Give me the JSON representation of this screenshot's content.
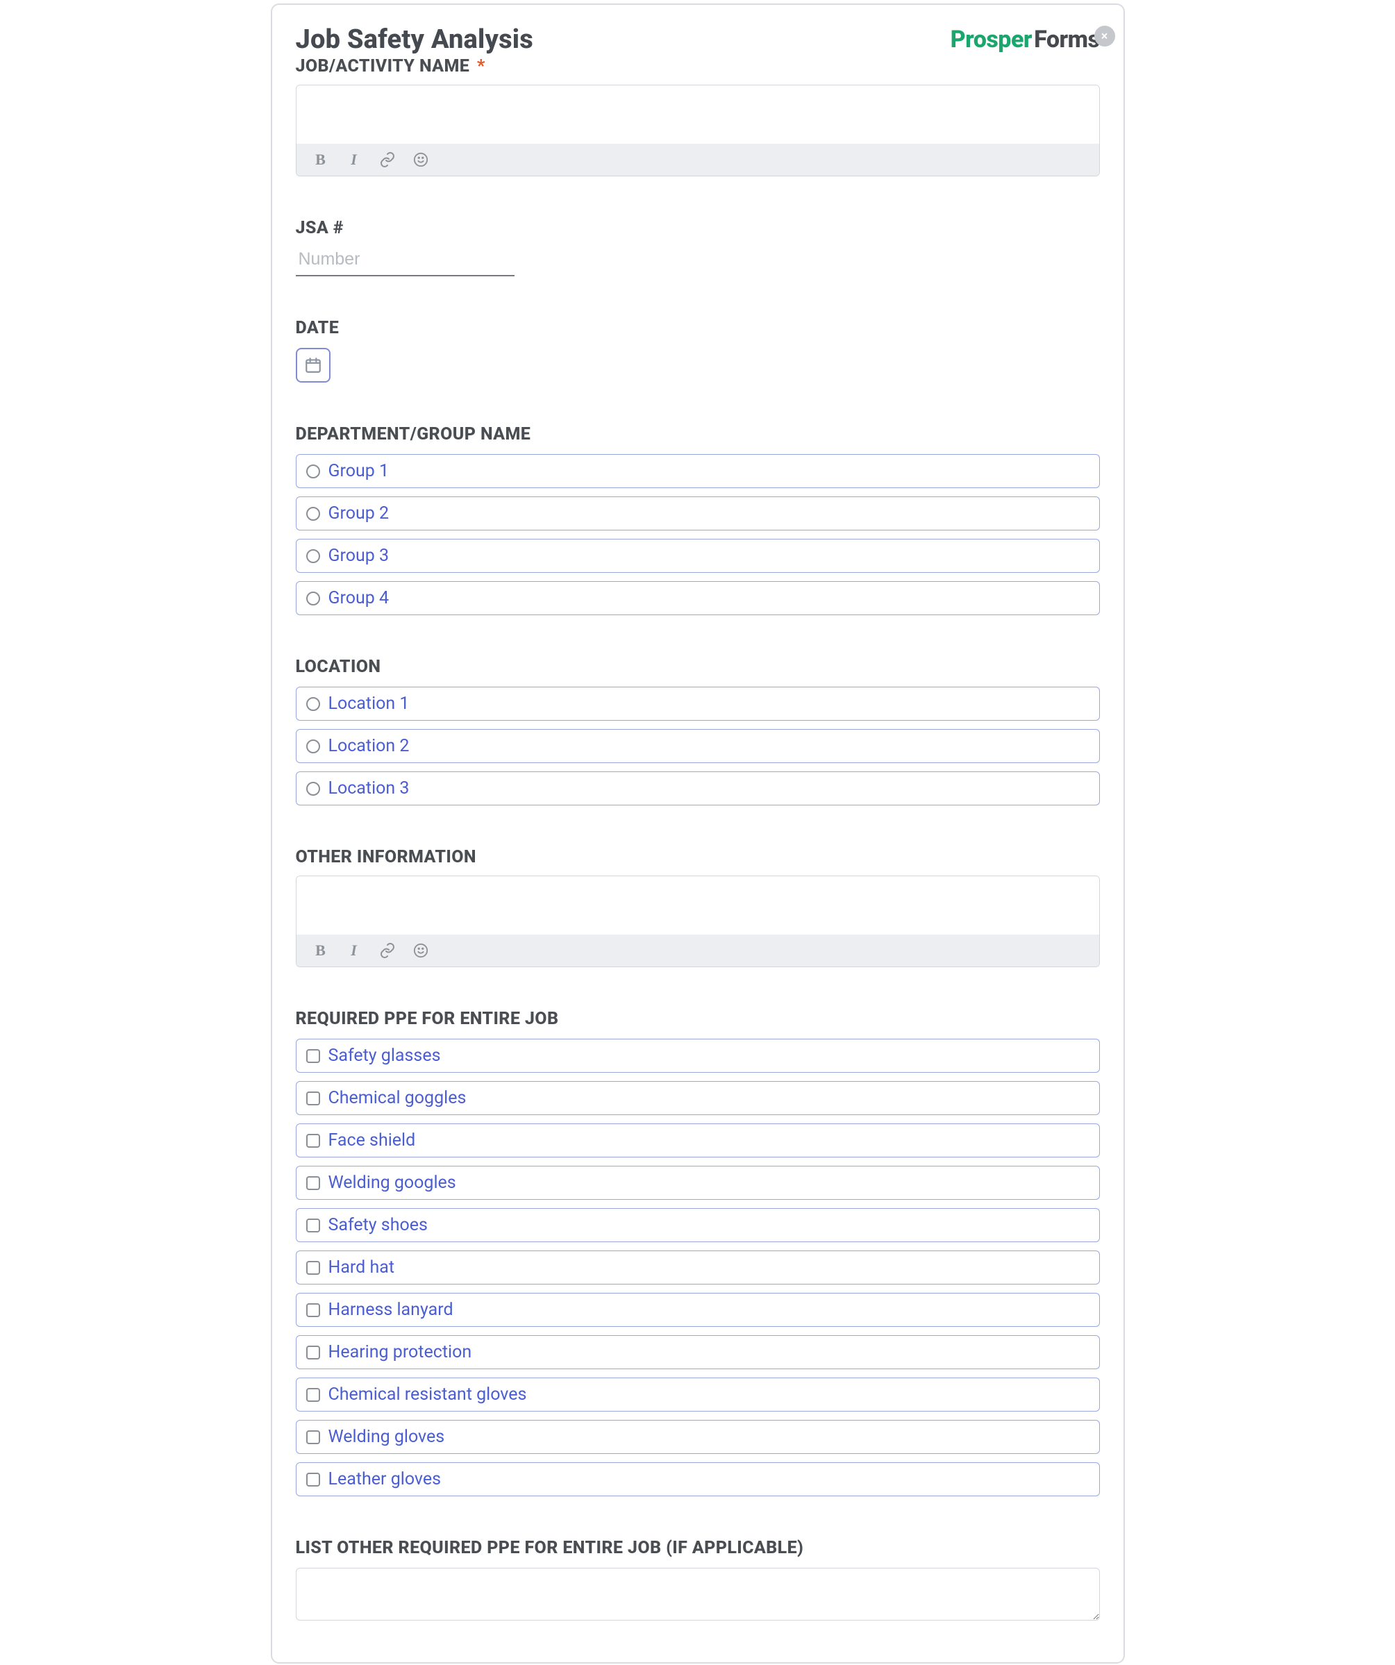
{
  "brand": {
    "part1": "Prosper",
    "part2": "Forms"
  },
  "title": "Job Safety Analysis",
  "close_label": "×",
  "fields": {
    "job_name": {
      "label": "JOB/ACTIVITY NAME",
      "required_mark": "*"
    },
    "jsa_number": {
      "label": "JSA #",
      "placeholder": "Number"
    },
    "date": {
      "label": "DATE"
    },
    "department": {
      "label": "DEPARTMENT/GROUP NAME",
      "options": [
        "Group 1",
        "Group 2",
        "Group 3",
        "Group 4"
      ]
    },
    "location": {
      "label": "LOCATION",
      "options": [
        "Location 1",
        "Location 2",
        "Location 3"
      ]
    },
    "other_info": {
      "label": "OTHER INFORMATION"
    },
    "ppe": {
      "label": "REQUIRED PPE FOR ENTIRE JOB",
      "options": [
        "Safety glasses",
        "Chemical goggles",
        "Face shield",
        "Welding googles",
        "Safety shoes",
        "Hard hat",
        "Harness lanyard",
        "Hearing protection",
        "Chemical resistant gloves",
        "Welding gloves",
        "Leather gloves"
      ]
    },
    "other_ppe": {
      "label": "LIST OTHER REQUIRED PPE FOR ENTIRE JOB (IF APPLICABLE)"
    }
  },
  "rte_icons": {
    "bold": "B",
    "italic": "I"
  }
}
